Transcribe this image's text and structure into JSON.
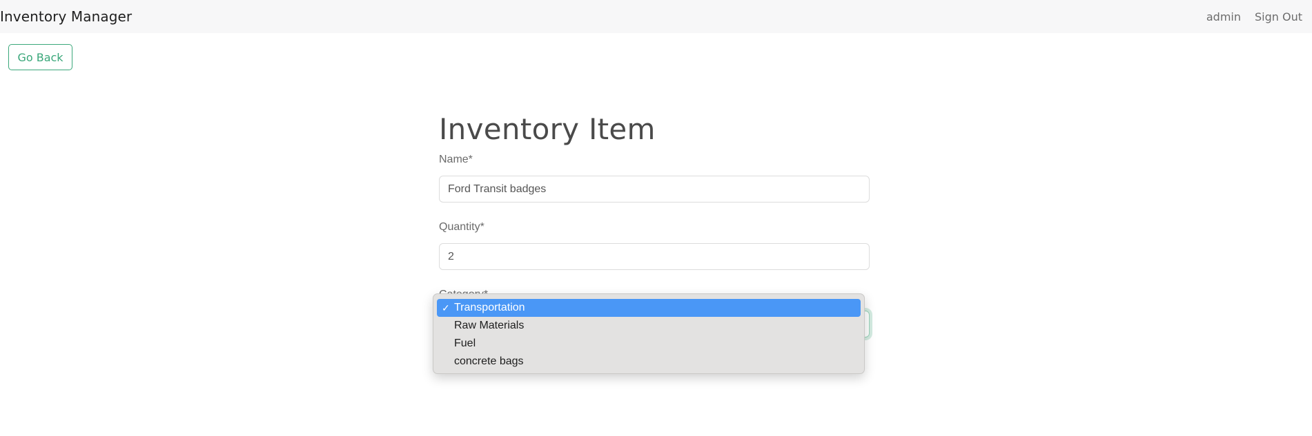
{
  "app": {
    "title": "Inventory Manager"
  },
  "nav": {
    "user": "admin",
    "sign_out": "Sign Out"
  },
  "actions": {
    "go_back": "Go Back"
  },
  "form": {
    "title": "Inventory Item",
    "name": {
      "label": "Name*",
      "value": "Ford Transit badges"
    },
    "quantity": {
      "label": "Quantity*",
      "value": "2"
    },
    "category": {
      "label": "Category*",
      "selected": "Transportation",
      "options": [
        "Transportation",
        "Raw Materials",
        "Fuel",
        "concrete bags"
      ]
    }
  },
  "icons": {
    "check": "checkmark-icon"
  },
  "colors": {
    "accent": "#3aa77a",
    "highlight": "#4a97f6",
    "navbar_bg": "#f7f7f8"
  }
}
